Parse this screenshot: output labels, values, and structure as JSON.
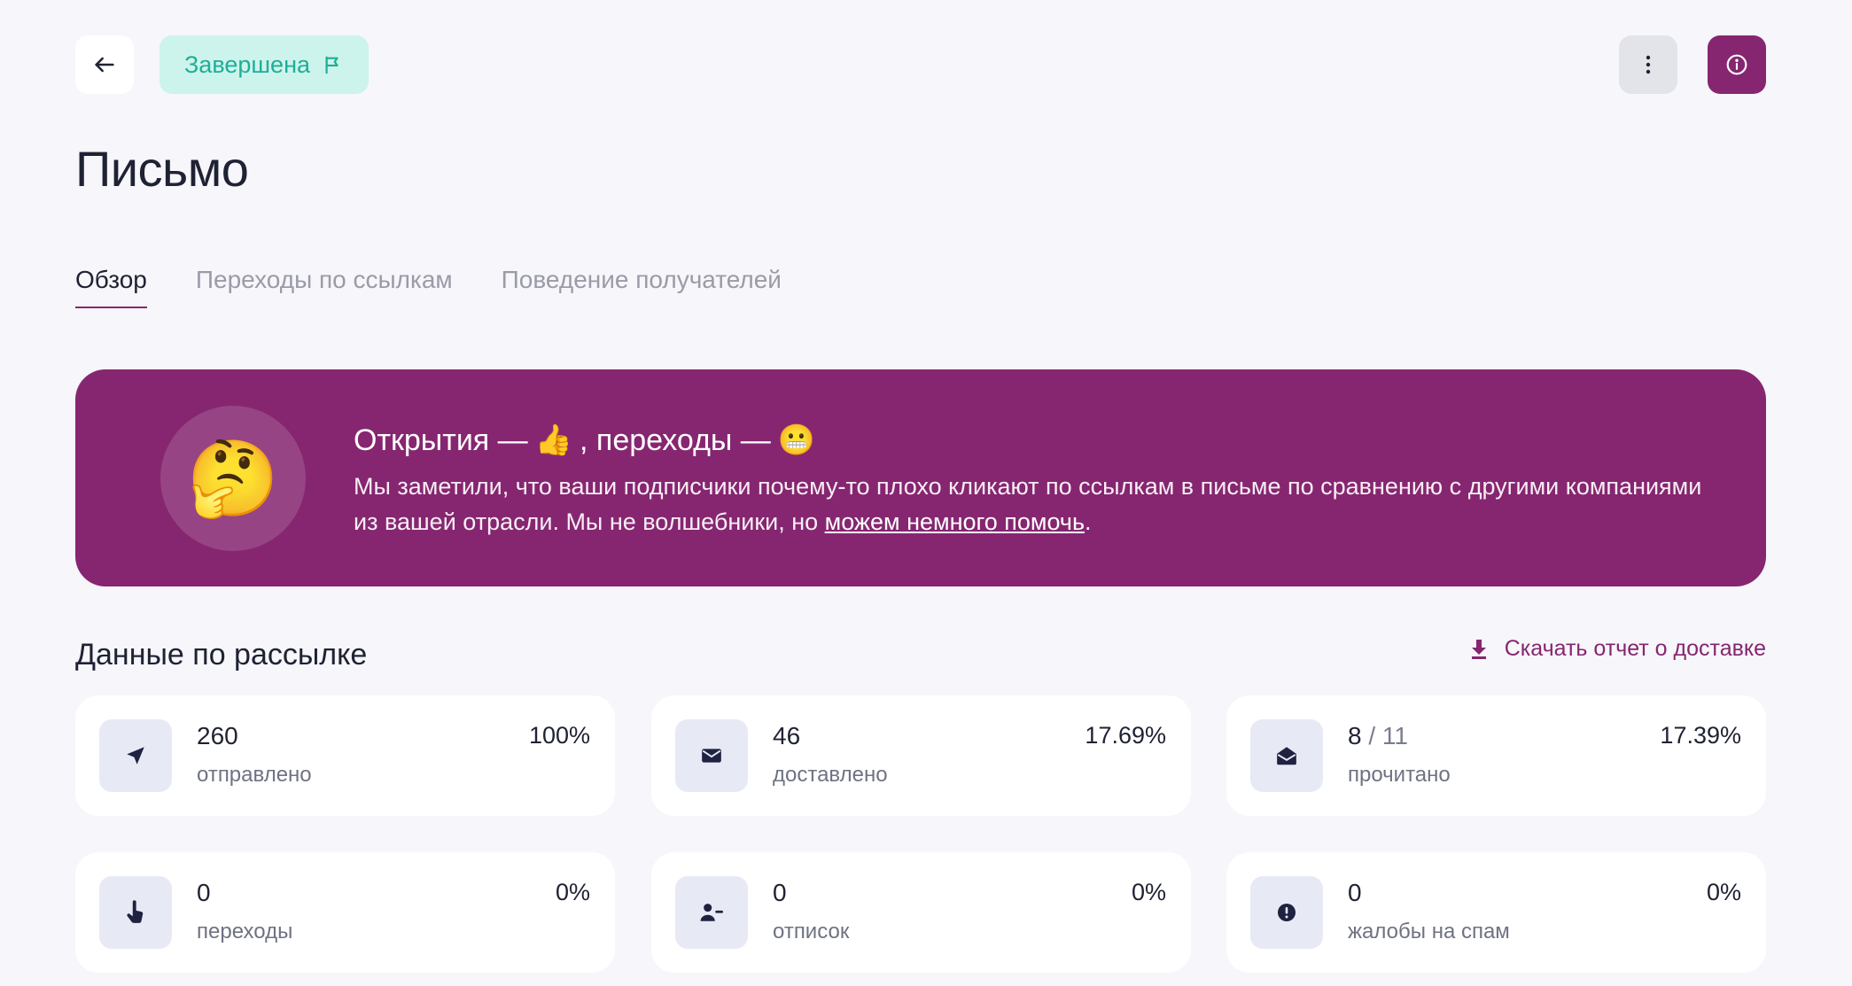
{
  "colors": {
    "accent": "#862670",
    "status_bg": "#cdf4ec",
    "status_text": "#1fae98",
    "icon_tile": "#e7eaf5",
    "icon_fg": "#1f2240"
  },
  "header": {
    "status_label": "Завершена",
    "back_icon": "arrow-left-icon",
    "status_icon": "flag-icon",
    "more_icon": "more-vertical-icon",
    "info_icon": "info-icon"
  },
  "page": {
    "title": "Письмо"
  },
  "tabs": [
    {
      "label": "Обзор",
      "active": true
    },
    {
      "label": "Переходы по ссылкам",
      "active": false
    },
    {
      "label": "Поведение получателей",
      "active": false
    }
  ],
  "banner": {
    "emoji": "🤔",
    "title_part1": "Открытия —",
    "title_emoji1": "👍",
    "title_part2": ", переходы —",
    "title_emoji2": "😬",
    "text": "Мы заметили, что ваши подписчики почему-то плохо кликают по ссылкам в письме по сравнению с другими компаниями из вашей отрасли. Мы не волшебники, но ",
    "link_text": "можем немного помочь",
    "text_end": "."
  },
  "stats": {
    "section_title": "Данные по рассылке",
    "download_label": "Скачать отчет о доставке",
    "download_icon": "download-icon",
    "cards": [
      {
        "icon": "send-icon",
        "value": "260",
        "label": "отправлено",
        "percent": "100%"
      },
      {
        "icon": "envelope-icon",
        "value": "46",
        "label": "доставлено",
        "percent": "17.69%"
      },
      {
        "icon": "envelope-open-icon",
        "value": "8",
        "value_total": " / 11",
        "label": "прочитано",
        "percent": "17.39%"
      },
      {
        "icon": "pointer-icon",
        "value": "0",
        "label": "переходы",
        "percent": "0%"
      },
      {
        "icon": "user-minus-icon",
        "value": "0",
        "label": "отписок",
        "percent": "0%"
      },
      {
        "icon": "alert-icon",
        "value": "0",
        "label": "жалобы на спам",
        "percent": "0%"
      }
    ]
  }
}
